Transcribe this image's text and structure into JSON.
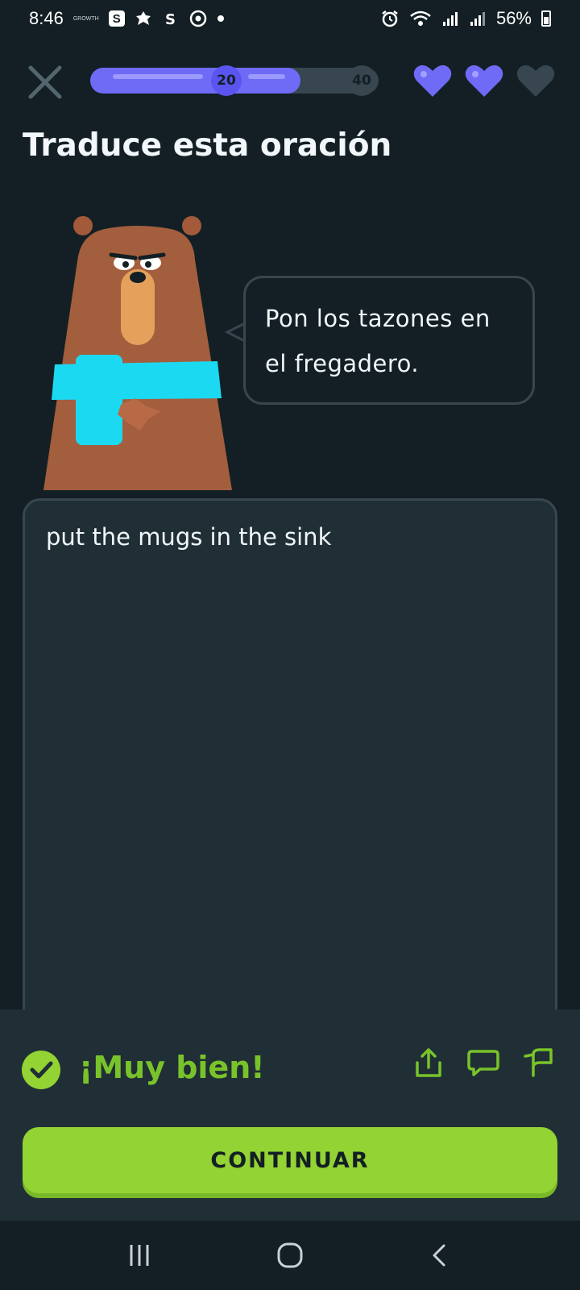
{
  "status_bar": {
    "time": "8:46",
    "small_label": "GROWTH",
    "badge_letter": "S",
    "battery": "56%"
  },
  "lesson": {
    "progress_fraction": 0.73,
    "milestone_1": "20",
    "milestone_2": "40",
    "hearts": [
      {
        "state": "full",
        "color": "#6f6bf7"
      },
      {
        "state": "full",
        "color": "#6f6bf7"
      },
      {
        "state": "empty",
        "color": "#37464f"
      }
    ]
  },
  "title": "Traduce esta oración",
  "prompt": {
    "line1": "Pon los tazones en",
    "line2": "el fregadero."
  },
  "answer": {
    "text": "put the mugs in the sink"
  },
  "feedback": {
    "title": "¡Muy bien!",
    "color": "#79c32a",
    "continue_label": "CONTINUAR",
    "icons": [
      "share-icon",
      "comment-icon",
      "report-flag-icon"
    ]
  },
  "colors": {
    "background": "#131f24",
    "panel": "#202f36",
    "accent_green": "#93d333",
    "progress": "#6f6bf7"
  }
}
